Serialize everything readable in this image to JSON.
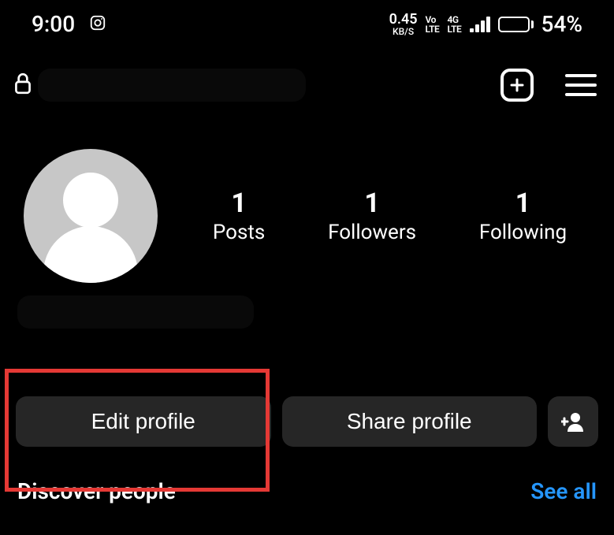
{
  "status": {
    "time": "9:00",
    "data_rate_top": "0.45",
    "data_rate_bottom": "KB/S",
    "volte": "Vo LTE",
    "network": "4G LTE",
    "battery_pct": "54%"
  },
  "stats": {
    "posts": {
      "value": "1",
      "label": "Posts"
    },
    "followers": {
      "value": "1",
      "label": "Followers"
    },
    "following": {
      "value": "1",
      "label": "Following"
    }
  },
  "actions": {
    "edit": "Edit profile",
    "share": "Share profile"
  },
  "discover": {
    "title": "Discover people",
    "see_all": "See all"
  }
}
